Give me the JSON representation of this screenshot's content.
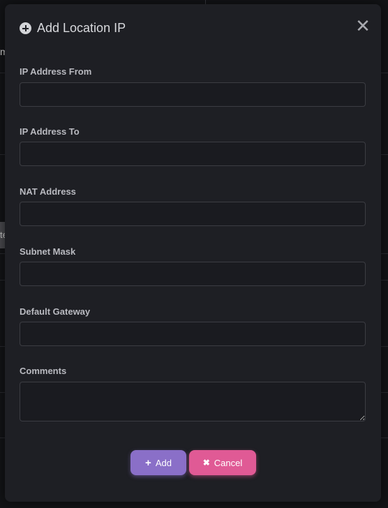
{
  "background": {
    "partial_text": "m",
    "partial_tab": "te"
  },
  "dialog": {
    "title": "Add Location IP",
    "title_icon": "plus-circle-icon",
    "close_glyph": "✕",
    "fields": [
      {
        "label": "IP Address From",
        "value": ""
      },
      {
        "label": "IP Address To",
        "value": ""
      },
      {
        "label": "NAT Address",
        "value": ""
      },
      {
        "label": "Subnet Mask",
        "value": ""
      },
      {
        "label": "Default Gateway",
        "value": ""
      },
      {
        "label": "Comments",
        "value": ""
      }
    ],
    "buttons": {
      "add_label": "Add",
      "add_icon": "+",
      "cancel_label": "Cancel",
      "cancel_icon": "✖"
    }
  },
  "colors": {
    "modal_bg": "#1e1f24",
    "add_button": "#8a6fc8",
    "cancel_button": "#e05a95"
  }
}
